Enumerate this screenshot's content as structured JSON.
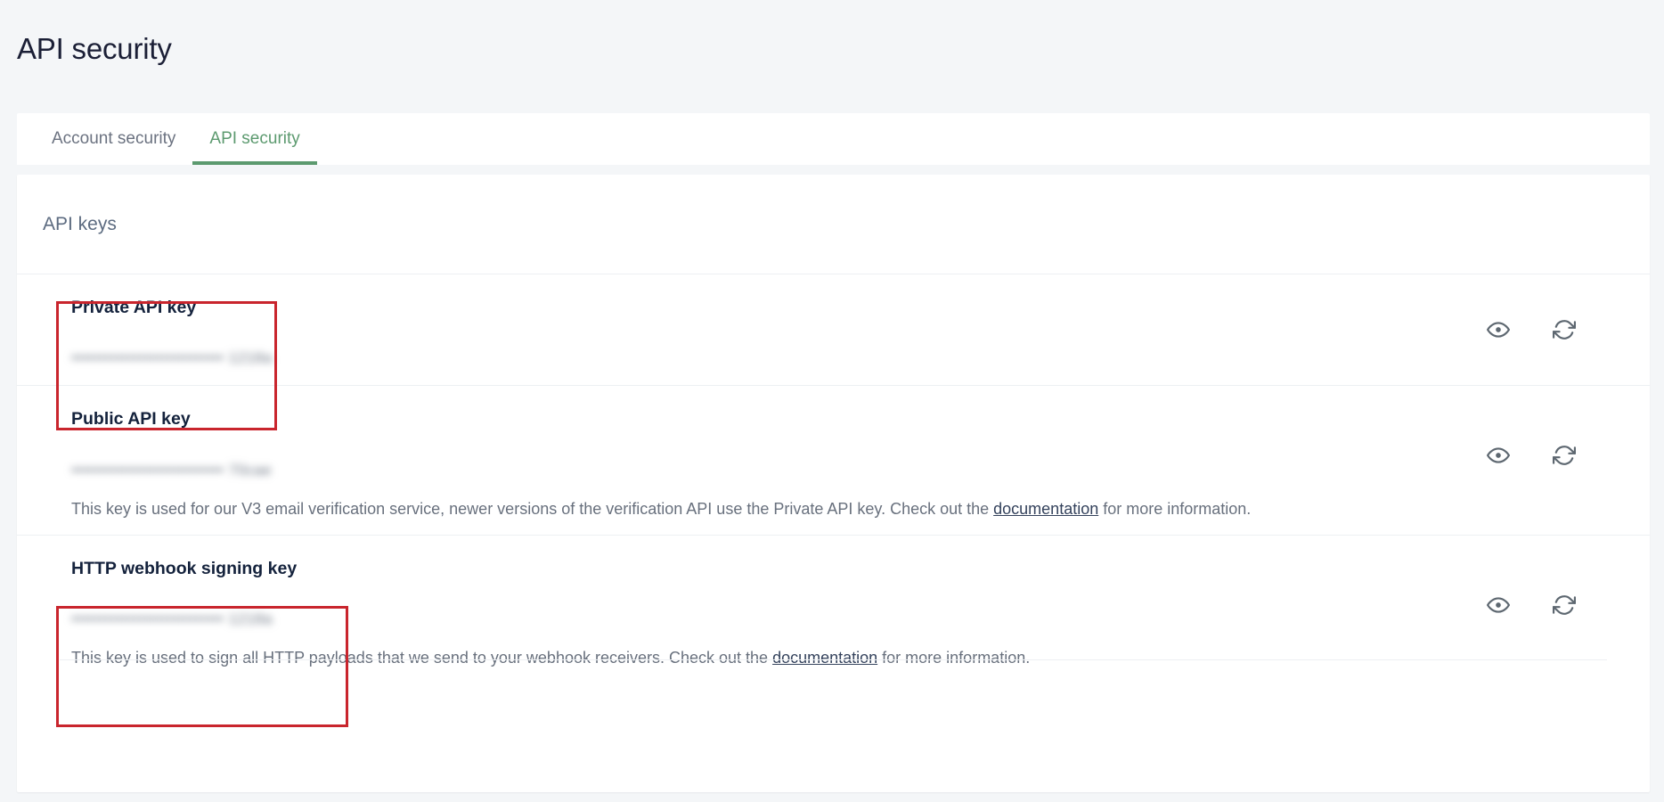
{
  "page": {
    "title": "API security"
  },
  "tabs": [
    {
      "label": "Account security",
      "active": false
    },
    {
      "label": "API security",
      "active": true
    }
  ],
  "card": {
    "header_title": "API keys"
  },
  "keys": [
    {
      "name": "Private API key",
      "masked_value": "••••••••••••••••••••••••••• 1218a",
      "description": "",
      "show_icon": "eye-icon",
      "regenerate_icon": "refresh-icon",
      "annotated": true
    },
    {
      "name": "Public API key",
      "masked_value": "••••••••••••••••••••••••••• 70cae",
      "description_before": "This key is used for our V3 email verification service, newer versions of the verification API use the Private API key. Check out the ",
      "description_link": "documentation",
      "description_after": " for more information.",
      "show_icon": "eye-icon",
      "regenerate_icon": "refresh-icon",
      "annotated": false
    },
    {
      "name": "HTTP webhook signing key",
      "masked_value": "••••••••••••••••••••••••••• 1218a",
      "description_before": "This key is used to sign all HTTP payloads that we send to your webhook receivers. Check out the ",
      "description_link": "documentation",
      "description_after": " for more information.",
      "show_icon": "eye-icon",
      "regenerate_icon": "refresh-icon",
      "annotated": true
    }
  ],
  "colors": {
    "accent_green": "#5c9a6f",
    "annotation_red": "#c9252d",
    "title_dark": "#1b1f36",
    "body_gray": "#68707d",
    "page_bg": "#f4f6f8"
  }
}
